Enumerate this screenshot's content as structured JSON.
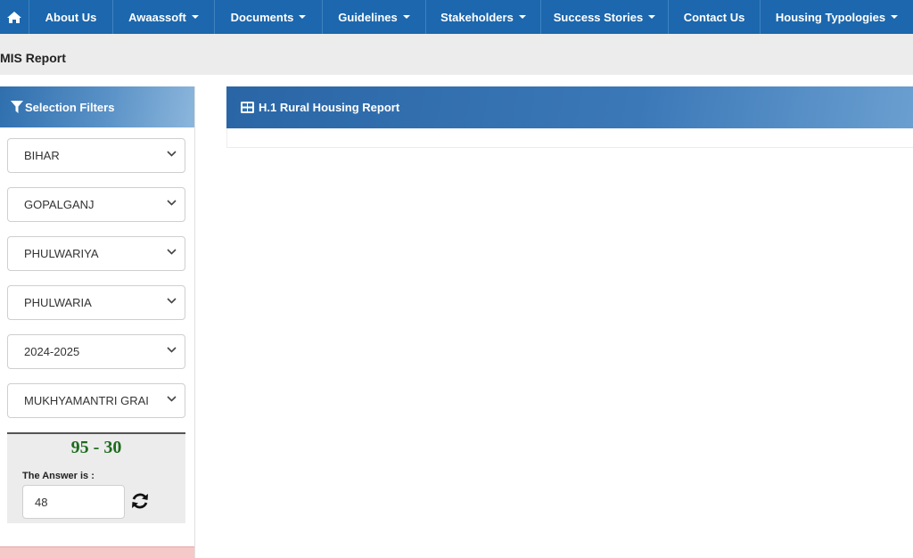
{
  "nav": {
    "home_icon": "home-icon",
    "items": [
      {
        "label": "About Us",
        "dropdown": false
      },
      {
        "label": "Awaassoft",
        "dropdown": true
      },
      {
        "label": "Documents",
        "dropdown": true
      },
      {
        "label": "Guidelines",
        "dropdown": true
      },
      {
        "label": "Stakeholders",
        "dropdown": true
      },
      {
        "label": "Success Stories",
        "dropdown": true
      },
      {
        "label": "Contact Us",
        "dropdown": false
      },
      {
        "label": "Housing Typologies",
        "dropdown": true
      }
    ]
  },
  "page": {
    "title": "MIS Report"
  },
  "filters": {
    "header": "Selection Filters",
    "selects": [
      {
        "value": "BIHAR"
      },
      {
        "value": "GOPALGANJ"
      },
      {
        "value": "PHULWARIYA"
      },
      {
        "value": "PHULWARIA"
      },
      {
        "value": "2024-2025"
      },
      {
        "value": "MUKHYAMANTRI GRAI"
      }
    ]
  },
  "captcha": {
    "question": "95 - 30",
    "answer_label": "The Answer is :",
    "answer_value": "48"
  },
  "report": {
    "title": "H.1 Rural Housing Report"
  },
  "colors": {
    "nav": "#1c67ad",
    "captcha_text": "#1e6b1e",
    "alert_strip": "#f6c9c9"
  }
}
